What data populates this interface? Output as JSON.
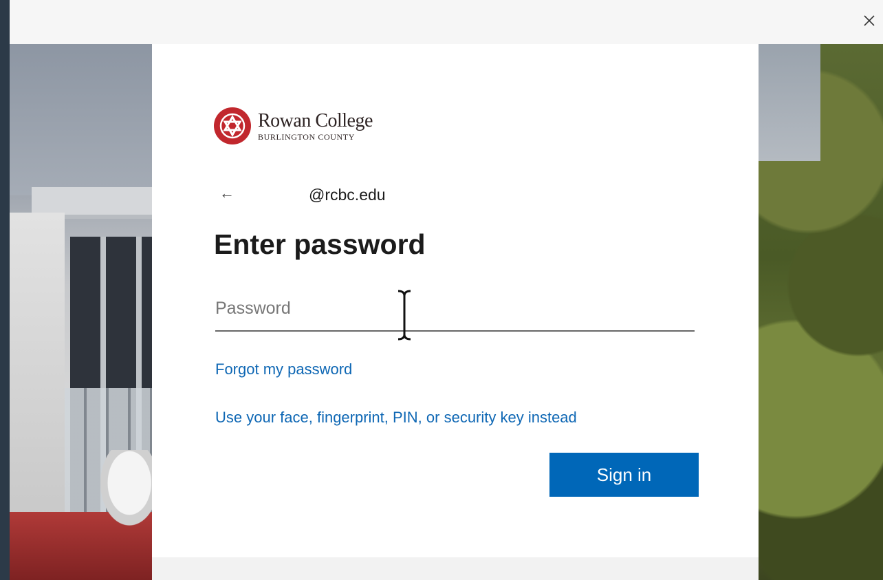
{
  "window": {
    "close_icon": "close-icon"
  },
  "brand": {
    "name": "Rowan College",
    "sub": "BURLINGTON COUNTY",
    "accent": "#c1272d"
  },
  "account": {
    "back_icon": "arrow-left-icon",
    "back_glyph": "←",
    "email": "@rcbc.edu"
  },
  "form": {
    "title": "Enter password",
    "password_placeholder": "Password",
    "password_value": "",
    "forgot_link": "Forgot my password",
    "alt_signin_link": "Use your face, fingerprint, PIN, or security key instead",
    "signin_button": "Sign in"
  },
  "colors": {
    "primary": "#0067b8",
    "link": "#0e67b4"
  }
}
